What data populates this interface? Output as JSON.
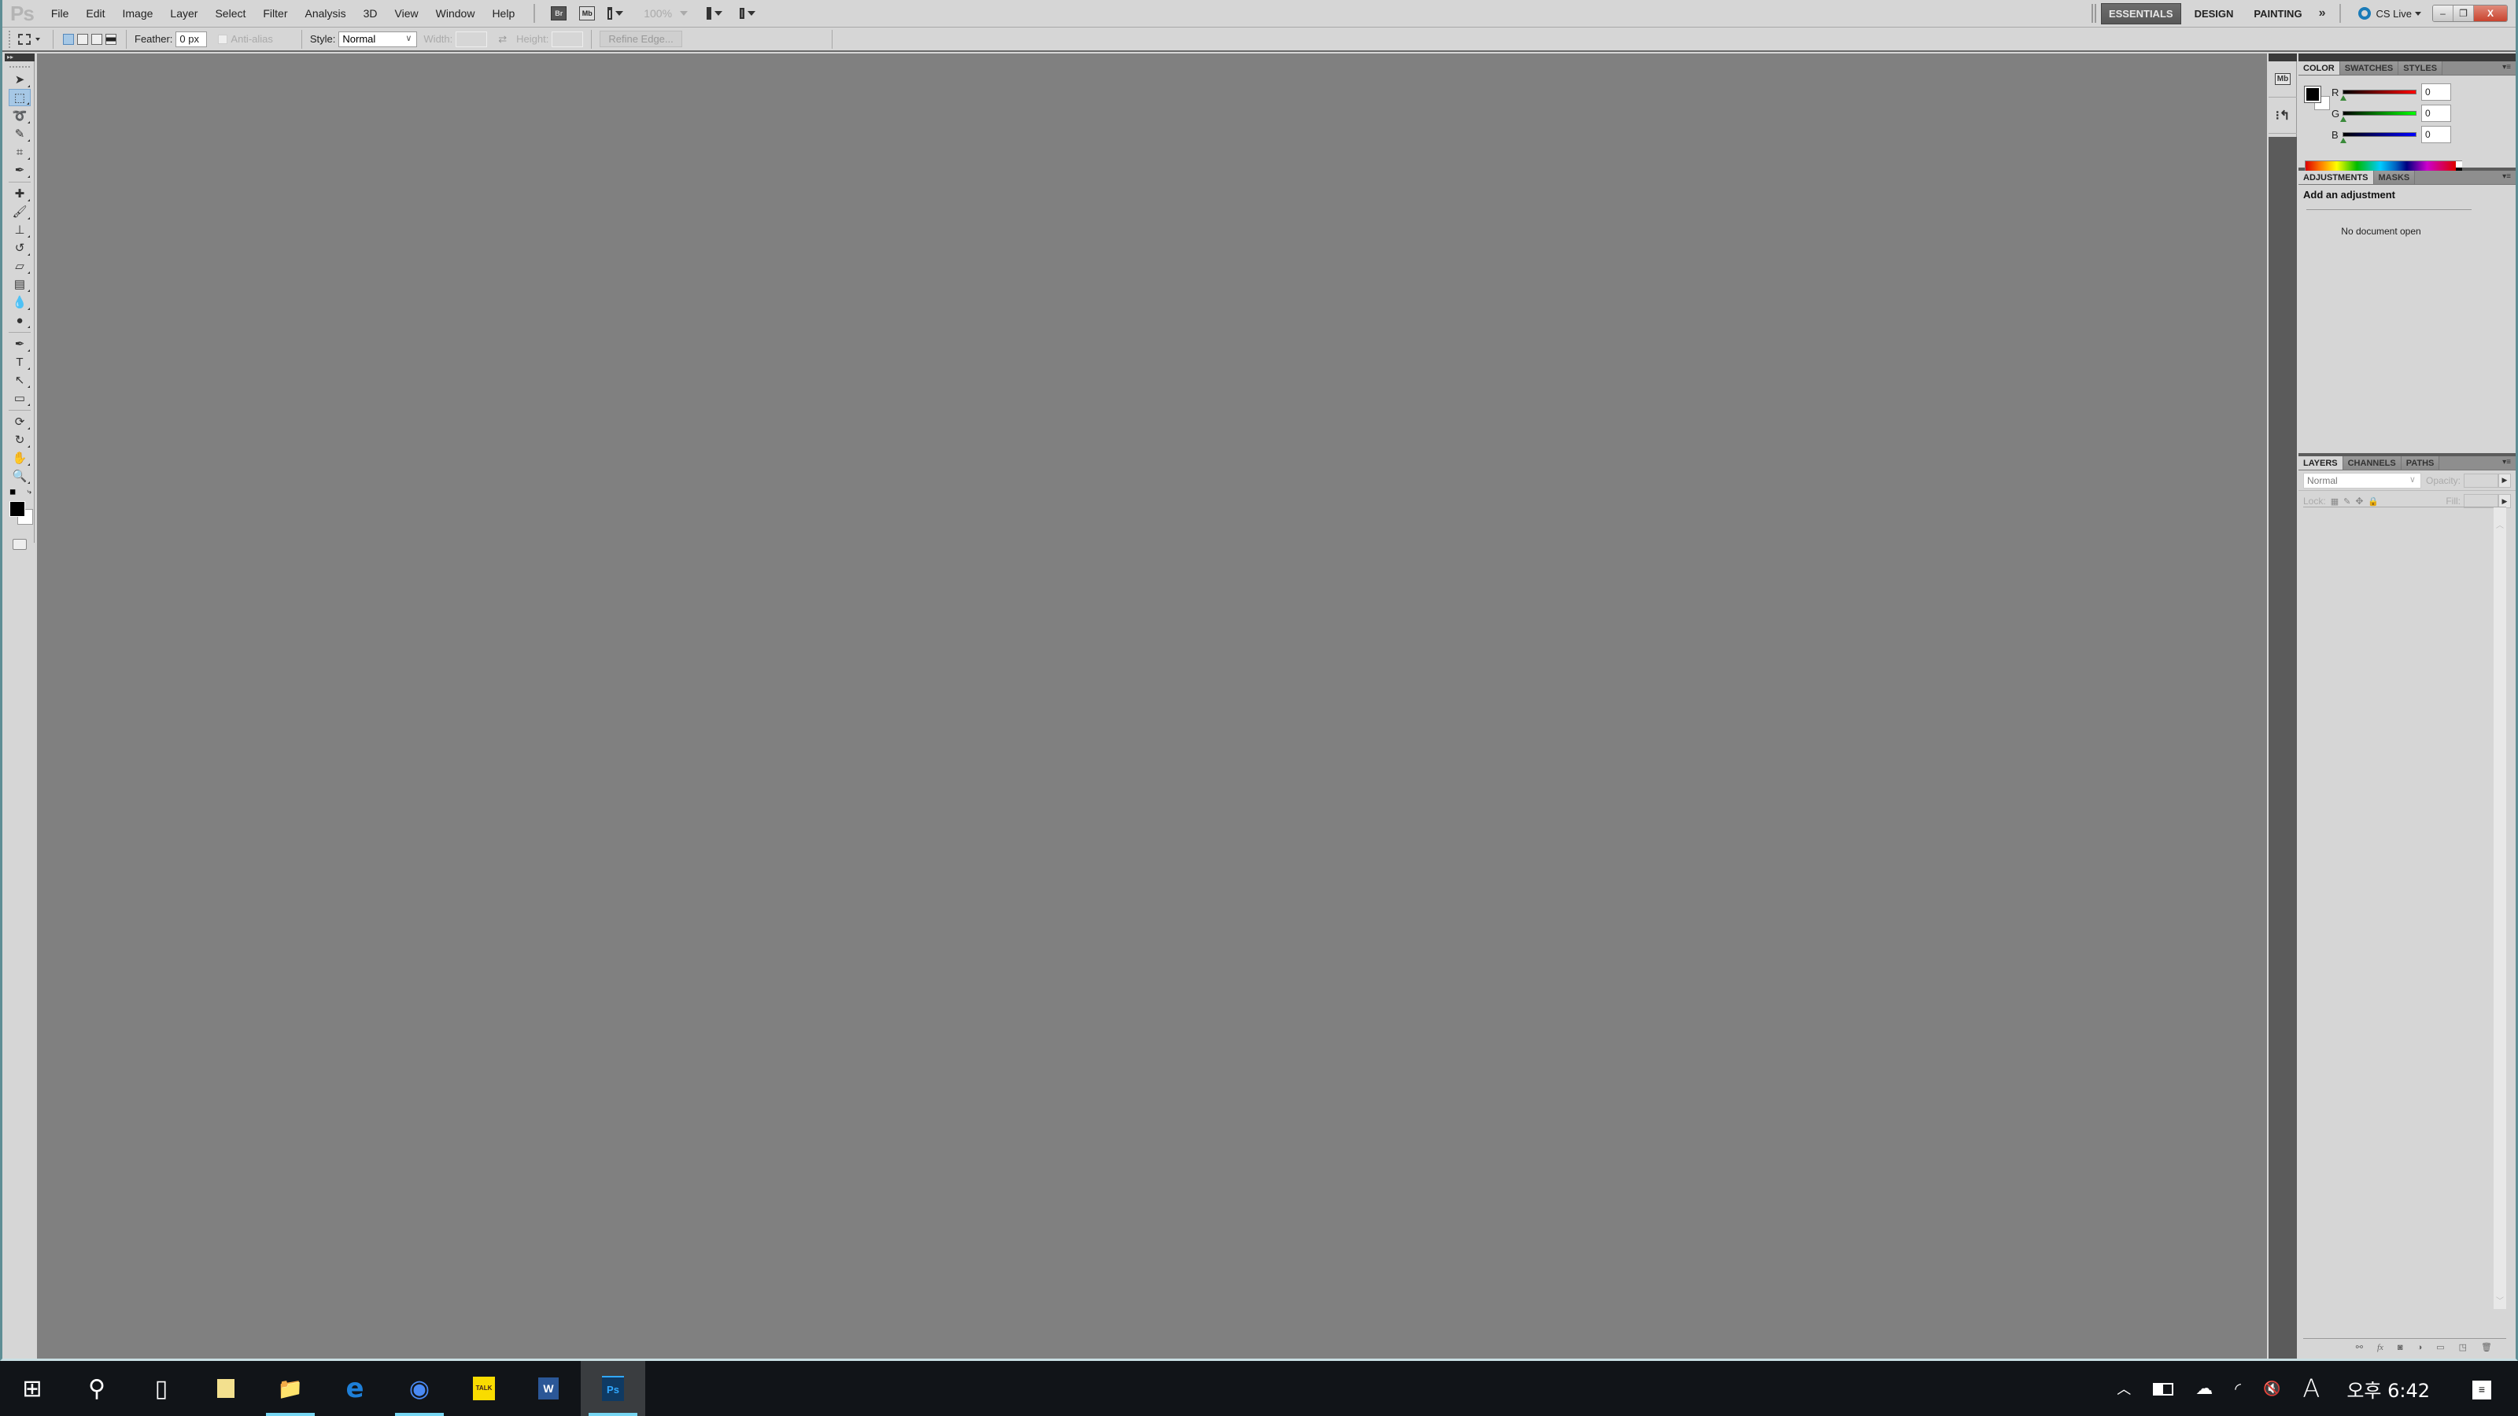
{
  "app": {
    "logo": "Ps",
    "menu": [
      "File",
      "Edit",
      "Image",
      "Layer",
      "Select",
      "Filter",
      "Analysis",
      "3D",
      "View",
      "Window",
      "Help"
    ],
    "app_bar": {
      "bridge_label": "Br",
      "minibridge_label": "Mb",
      "zoom_level": "100%"
    },
    "workspaces": {
      "items": [
        "ESSENTIALS",
        "DESIGN",
        "PAINTING"
      ],
      "active": "ESSENTIALS",
      "more_label": "»",
      "cs_live_label": "CS Live"
    },
    "window_controls": {
      "minimize": "–",
      "restore": "❐",
      "close": "X"
    }
  },
  "options_bar": {
    "feather_label": "Feather:",
    "feather_value": "0 px",
    "anti_alias_label": "Anti-alias",
    "style_label": "Style:",
    "style_value": "Normal",
    "width_label": "Width:",
    "height_label": "Height:",
    "refine_edge_label": "Refine Edge..."
  },
  "tools": [
    {
      "name": "move-tool",
      "glyph": "➤",
      "active": false
    },
    {
      "name": "rectangular-marquee-tool",
      "glyph": "⬚",
      "active": true
    },
    {
      "name": "lasso-tool",
      "glyph": "➰",
      "active": false
    },
    {
      "name": "quick-selection-tool",
      "glyph": "✎",
      "active": false
    },
    {
      "name": "crop-tool",
      "glyph": "⌗",
      "active": false
    },
    {
      "name": "eyedropper-tool",
      "glyph": "✒",
      "active": false
    },
    {
      "name": "spot-healing-brush-tool",
      "glyph": "✚",
      "active": false
    },
    {
      "name": "brush-tool",
      "glyph": "🖌",
      "active": false
    },
    {
      "name": "clone-stamp-tool",
      "glyph": "⊥",
      "active": false
    },
    {
      "name": "history-brush-tool",
      "glyph": "↺",
      "active": false
    },
    {
      "name": "eraser-tool",
      "glyph": "▱",
      "active": false
    },
    {
      "name": "gradient-tool",
      "glyph": "▤",
      "active": false
    },
    {
      "name": "blur-tool",
      "glyph": "💧",
      "active": false
    },
    {
      "name": "dodge-tool",
      "glyph": "●",
      "active": false
    },
    {
      "name": "pen-tool",
      "glyph": "✒",
      "active": false
    },
    {
      "name": "type-tool",
      "glyph": "T",
      "active": false
    },
    {
      "name": "path-selection-tool",
      "glyph": "↖",
      "active": false
    },
    {
      "name": "rectangle-tool",
      "glyph": "▭",
      "active": false
    },
    {
      "name": "3d-rotate-tool",
      "glyph": "⟳",
      "active": false
    },
    {
      "name": "3d-orbit-tool",
      "glyph": "↻",
      "active": false
    },
    {
      "name": "hand-tool",
      "glyph": "✋",
      "active": false
    },
    {
      "name": "zoom-tool",
      "glyph": "🔍",
      "active": false
    }
  ],
  "colors": {
    "foreground": "#000000",
    "background": "#ffffff",
    "accent_blue": "#a6c8e6",
    "taskbar_indicator": "#76d5f2"
  },
  "panels": {
    "color": {
      "tabs": [
        "COLOR",
        "SWATCHES",
        "STYLES"
      ],
      "active_tab": "COLOR",
      "channels": [
        {
          "label": "R",
          "value": "0",
          "color": "#ff0000"
        },
        {
          "label": "G",
          "value": "0",
          "color": "#00ff00"
        },
        {
          "label": "B",
          "value": "0",
          "color": "#0000ff"
        }
      ]
    },
    "adjustments": {
      "tabs": [
        "ADJUSTMENTS",
        "MASKS"
      ],
      "active_tab": "ADJUSTMENTS",
      "title": "Add an adjustment",
      "message": "No document open"
    },
    "layers": {
      "tabs": [
        "LAYERS",
        "CHANNELS",
        "PATHS"
      ],
      "active_tab": "LAYERS",
      "blend_mode": "Normal",
      "opacity_label": "Opacity:",
      "lock_label": "Lock:",
      "fill_label": "Fill:",
      "footer_icons": [
        "link-layers",
        "fx",
        "add-mask",
        "adjustment-layer",
        "new-group",
        "new-layer",
        "delete-layer"
      ]
    }
  },
  "dock": {
    "minibridge_label": "Mb",
    "history_label": "History"
  },
  "taskbar": {
    "apps": [
      {
        "name": "start",
        "glyph": "⊞",
        "running": false,
        "active": false
      },
      {
        "name": "search",
        "glyph": "⚲",
        "running": false,
        "active": false
      },
      {
        "name": "task-view",
        "glyph": "▯",
        "running": false,
        "active": false
      },
      {
        "name": "sticky-notes",
        "glyph": "▰",
        "running": false,
        "active": false
      },
      {
        "name": "file-explorer",
        "glyph": "📁",
        "running": true,
        "active": false
      },
      {
        "name": "edge",
        "glyph": "e",
        "running": false,
        "active": false
      },
      {
        "name": "chrome",
        "glyph": "◉",
        "running": true,
        "active": false
      },
      {
        "name": "kakaotalk",
        "glyph": "TALK",
        "running": false,
        "active": false
      },
      {
        "name": "word",
        "glyph": "W",
        "running": false,
        "active": false
      },
      {
        "name": "photoshop",
        "glyph": "Ps",
        "running": true,
        "active": true
      }
    ],
    "tray": {
      "ime_label": "A",
      "clock": "오후 6:42"
    }
  }
}
